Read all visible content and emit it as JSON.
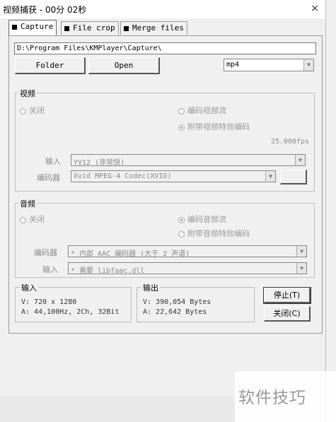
{
  "window": {
    "title": "视频捕获 - 00分 02秒",
    "close_glyph": "×"
  },
  "tabs": [
    {
      "label": "Capture",
      "active": true
    },
    {
      "label": "File crop",
      "active": false
    },
    {
      "label": "Merge files",
      "active": false
    }
  ],
  "capture": {
    "path": "D:\\Program Files\\KMPlayer\\Capture\\",
    "folder_label": "Folder",
    "open_label": "Open",
    "format": "mp4",
    "dropdown_glyph": "▼"
  },
  "video": {
    "group_label": "视频",
    "off_label": "关闭",
    "encode_stream_label": "编码视频流",
    "effects_encode_label": "附带视频特效编码",
    "fps": "25.000fps",
    "input_label": "输入",
    "input_value": "YV12 (非常快)",
    "encoder_label": "编码器",
    "encoder_value": "Xvid MPEG-4 Codec(XVID)"
  },
  "audio": {
    "group_label": "音频",
    "off_label": "关闭",
    "encode_stream_label": "编码音频流",
    "effects_encode_label": "附带音频特效编码",
    "encoder_label": "编码器",
    "encoder_value": "* 内部 AAC 编码器 (大于 2 声道)",
    "input_label": "输入",
    "input_value": "* 需要 libfaac.dll"
  },
  "input_info": {
    "label": "输入",
    "video": "V: 720 x 1280",
    "audio": "A: 44,100Hz, 2Ch, 32Bit"
  },
  "output_info": {
    "label": "输出",
    "video": "V: 390,054 Bytes",
    "audio": "A: 22,642 Bytes"
  },
  "actions": {
    "stop_label": "停止(T)",
    "close_label": "关闭(C)"
  },
  "watermark": {
    "text": "软件技巧"
  }
}
